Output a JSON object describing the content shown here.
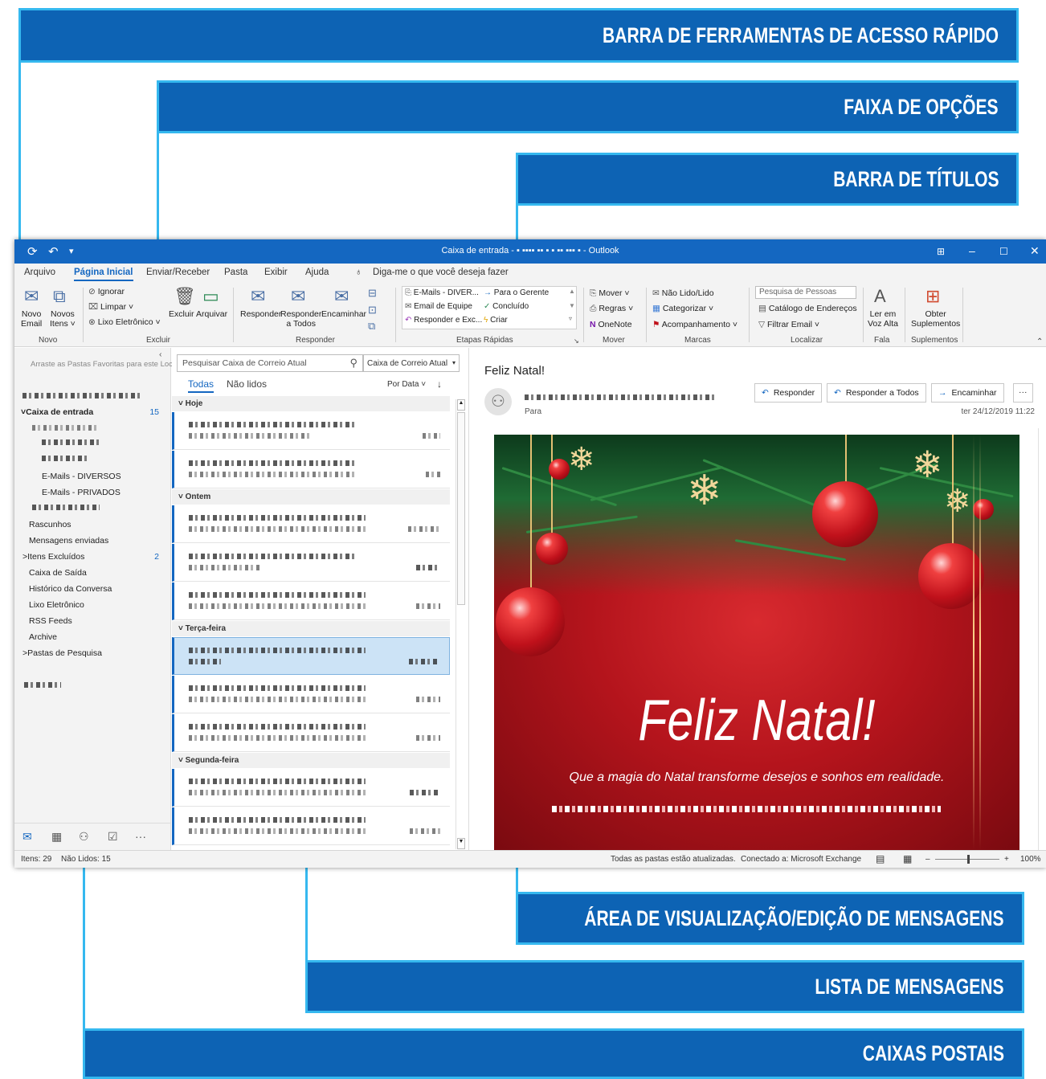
{
  "annotations": {
    "quick_access_toolbar": "BARRA DE FERRAMENTAS DE ACESSO RÁPIDO",
    "ribbon": "FAIXA DE OPÇÕES",
    "title_bar": "BARRA DE TÍTULOS",
    "reading_pane": "ÁREA DE VISUALIZAÇÃO/EDIÇÃO DE MENSAGENS",
    "message_list": "LISTA DE MENSAGENS",
    "mailboxes": "CAIXAS POSTAIS"
  },
  "colors": {
    "banner": "#0d63b4",
    "banner_border": "#35b8ef",
    "titlebar": "#1467c1"
  },
  "titlebar": {
    "title": "Caixa de entrada - ▪ ▪▪▪▪ ▪▪   ▪ ▪ ▪▪ ▪▪▪   ▪ - Outlook"
  },
  "tabs": [
    "Arquivo",
    "Página Inicial",
    "Enviar/Receber",
    "Pasta",
    "Exibir",
    "Ajuda",
    "Diga-me o que você deseja fazer"
  ],
  "ribbon": {
    "novo": {
      "novo_email": [
        "Novo",
        "Email"
      ],
      "novos_itens": [
        "Novos",
        "Itens ˅"
      ],
      "group": "Novo"
    },
    "excluir": {
      "ignorar": "Ignorar",
      "limpar": "Limpar ˅",
      "lixo": "Lixo Eletrônico ˅",
      "excluir": "Excluir",
      "arquivar": "Arquivar",
      "group": "Excluir"
    },
    "responder": {
      "responder": "Responder",
      "responder_todos": [
        "Responder",
        "a Todos"
      ],
      "encaminhar": "Encaminhar",
      "group": "Responder"
    },
    "etapas": {
      "items": [
        "E-Mails - DIVER...",
        "Para o Gerente",
        "Email de Equipe",
        "Concluído",
        "Responder e Exc...",
        "Criar"
      ],
      "group": "Etapas Rápidas"
    },
    "mover": {
      "mover": "Mover ˅",
      "regras": "Regras ˅",
      "onenote": "OneNote",
      "group": "Mover"
    },
    "marcas": {
      "nao_lido": "Não Lido/Lido",
      "categorizar": "Categorizar ˅",
      "acompanhamento": "Acompanhamento ˅",
      "group": "Marcas"
    },
    "localizar": {
      "pesquisa": "Pesquisa de Pessoas",
      "catalogo": "Catálogo de Endereços",
      "filtrar": "Filtrar Email ˅",
      "group": "Localizar"
    },
    "fala": {
      "ler": [
        "Ler em",
        "Voz Alta"
      ],
      "group": "Fala"
    },
    "suplementos": {
      "obter": [
        "Obter",
        "Suplementos"
      ],
      "group": "Suplementos"
    }
  },
  "folders": {
    "favorites_hint": "Arraste as Pastas Favoritas para este Loc",
    "inbox": "Caixa de entrada",
    "inbox_count": "15",
    "sub1": "E-Mails - DIVERSOS",
    "sub2": "E-Mails - PRIVADOS",
    "items": [
      "Rascunhos",
      "Mensagens enviadas",
      "Itens Excluídos",
      "Caixa de Saída",
      "Histórico da Conversa",
      "Lixo Eletrônico",
      "RSS Feeds",
      "Archive",
      "Pastas de Pesquisa"
    ],
    "deleted_count": "2"
  },
  "list": {
    "search_placeholder": "Pesquisar Caixa de Correio Atual",
    "scope": "Caixa de Correio Atual",
    "filter_all": "Todas",
    "filter_unread": "Não lidos",
    "sort": "Por Data ˅",
    "groups": [
      "Hoje",
      "Ontem",
      "Terça-feira",
      "Segunda-feira"
    ]
  },
  "reading": {
    "subject": "Feliz Natal!",
    "to": "Para",
    "reply": "Responder",
    "reply_all": "Responder a Todos",
    "forward": "Encaminhar",
    "more": "···",
    "date": "ter 24/12/2019 11:22",
    "card_title": "Feliz Natal!",
    "card_sub": "Que a magia do Natal transforme desejos e sonhos em realidade."
  },
  "status": {
    "items": "Itens: 29",
    "unread": "Não Lidos: 15",
    "updated": "Todas as pastas estão atualizadas.",
    "connected": "Conectado a: Microsoft Exchange",
    "zoom": "100%"
  }
}
